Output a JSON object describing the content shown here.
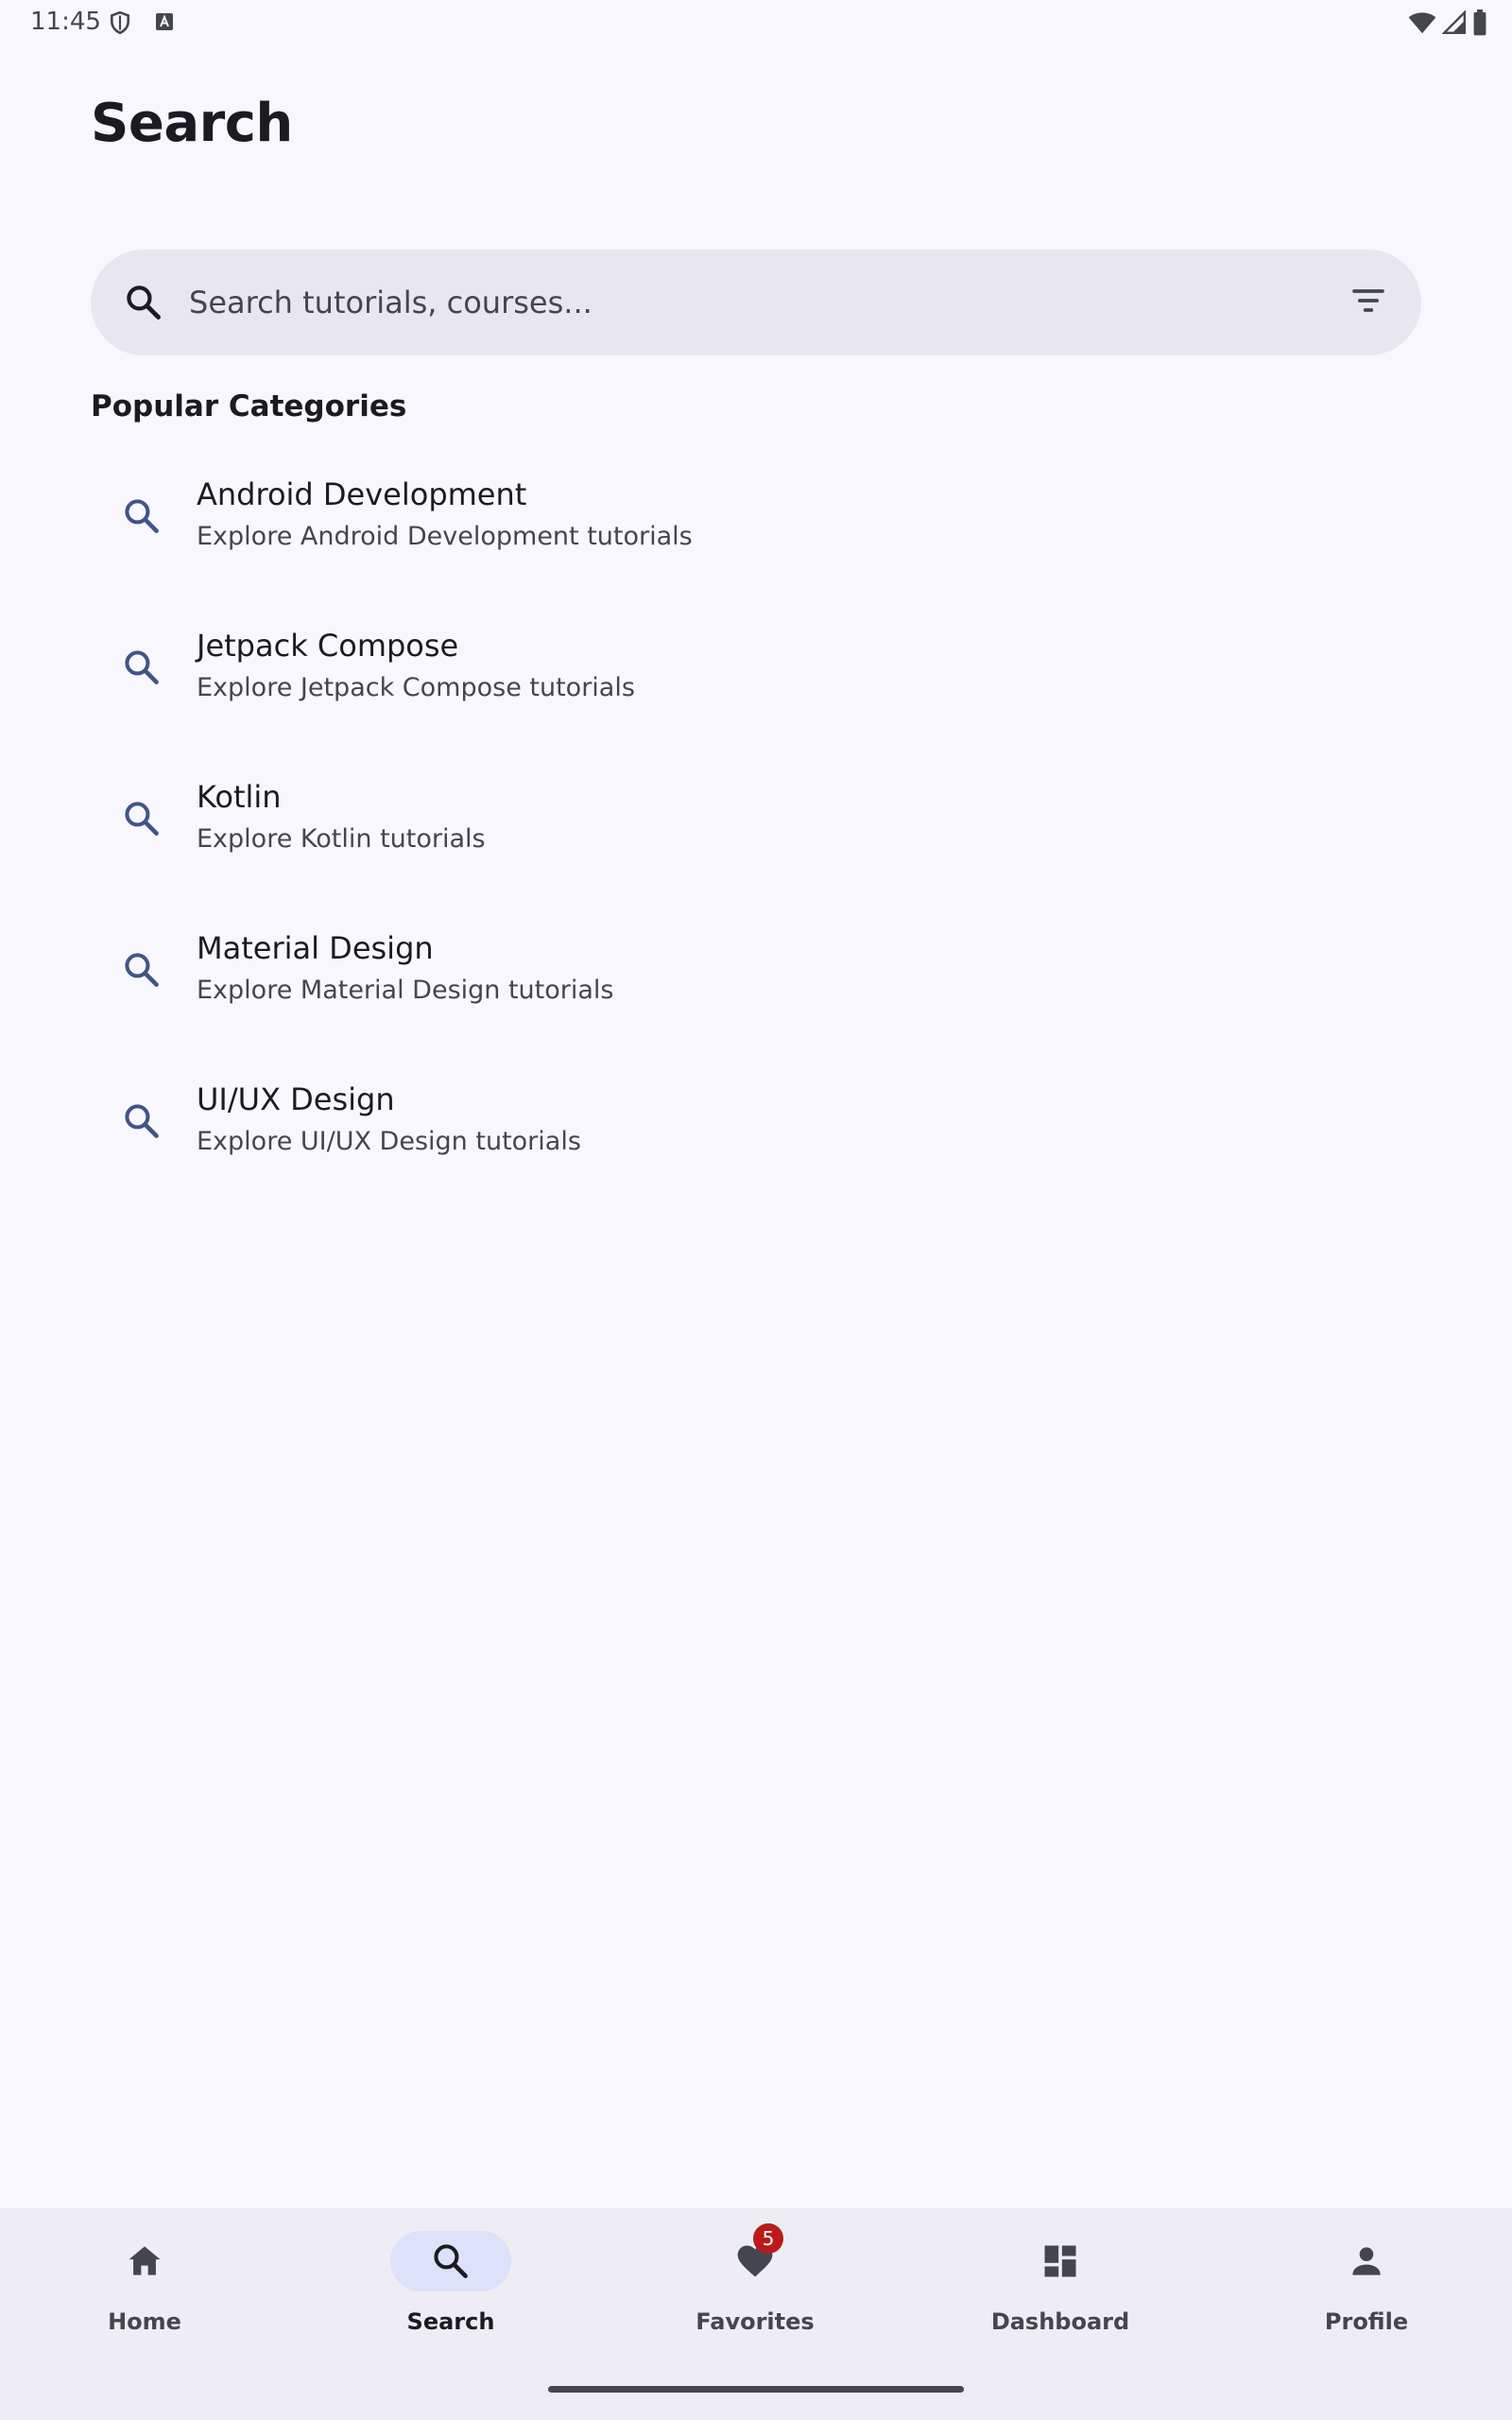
{
  "status_bar": {
    "time": "11:45",
    "icons": [
      "shield-icon",
      "keyboard-a-icon",
      "wifi-icon",
      "signal-icon",
      "battery-icon"
    ]
  },
  "header": {
    "title": "Search"
  },
  "search": {
    "placeholder": "Search tutorials, courses...",
    "value": ""
  },
  "section": {
    "title": "Popular Categories"
  },
  "categories": [
    {
      "title": "Android Development",
      "subtitle": "Explore Android Development tutorials"
    },
    {
      "title": "Jetpack Compose",
      "subtitle": "Explore Jetpack Compose tutorials"
    },
    {
      "title": "Kotlin",
      "subtitle": "Explore Kotlin tutorials"
    },
    {
      "title": "Material Design",
      "subtitle": "Explore Material Design tutorials"
    },
    {
      "title": "UI/UX Design",
      "subtitle": "Explore UI/UX Design tutorials"
    }
  ],
  "bottom_nav": {
    "items": [
      {
        "label": "Home",
        "icon": "home-icon"
      },
      {
        "label": "Search",
        "icon": "search-icon",
        "active": true
      },
      {
        "label": "Favorites",
        "icon": "heart-icon",
        "badge": "5"
      },
      {
        "label": "Dashboard",
        "icon": "dashboard-icon"
      },
      {
        "label": "Profile",
        "icon": "person-icon"
      }
    ]
  },
  "colors": {
    "background": "#f8f7fd",
    "search_bar": "#e8e7ef",
    "nav_background": "#eeedf4",
    "active_pill": "#dde1f9",
    "badge": "#ba1a1a",
    "icon_accent": "#3f5488"
  }
}
